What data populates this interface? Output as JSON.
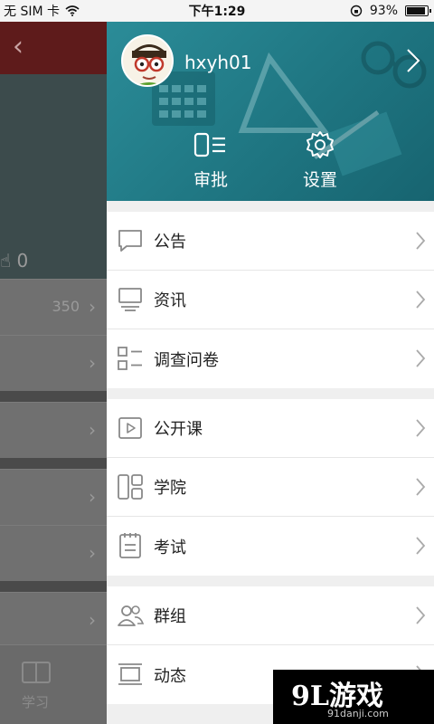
{
  "status_bar": {
    "carrier": "无 SIM 卡",
    "time": "下午1:29",
    "battery": "93%",
    "battery_level": 0.93
  },
  "background_page": {
    "count": "0",
    "row_value": "350",
    "tab_label": "学习"
  },
  "drawer": {
    "user": {
      "name": "hxyh01"
    },
    "quick_actions": [
      {
        "label": "审批",
        "icon": "approval-icon"
      },
      {
        "label": "设置",
        "icon": "gear-icon"
      }
    ],
    "sections": [
      {
        "items": [
          {
            "label": "公告",
            "icon": "chat-bubble-icon"
          },
          {
            "label": "资讯",
            "icon": "monitor-icon"
          },
          {
            "label": "调查问卷",
            "icon": "survey-list-icon"
          }
        ]
      },
      {
        "items": [
          {
            "label": "公开课",
            "icon": "video-play-icon"
          },
          {
            "label": "学院",
            "icon": "grid-layout-icon"
          },
          {
            "label": "考试",
            "icon": "exam-paper-icon"
          }
        ]
      },
      {
        "items": [
          {
            "label": "群组",
            "icon": "group-icon"
          },
          {
            "label": "动态",
            "icon": "feed-icon"
          }
        ]
      }
    ]
  },
  "watermark": {
    "logo": "9L游戏",
    "url": "91danji.com"
  },
  "colors": {
    "header": "#1f7682",
    "accent": "#5e1b1b"
  }
}
